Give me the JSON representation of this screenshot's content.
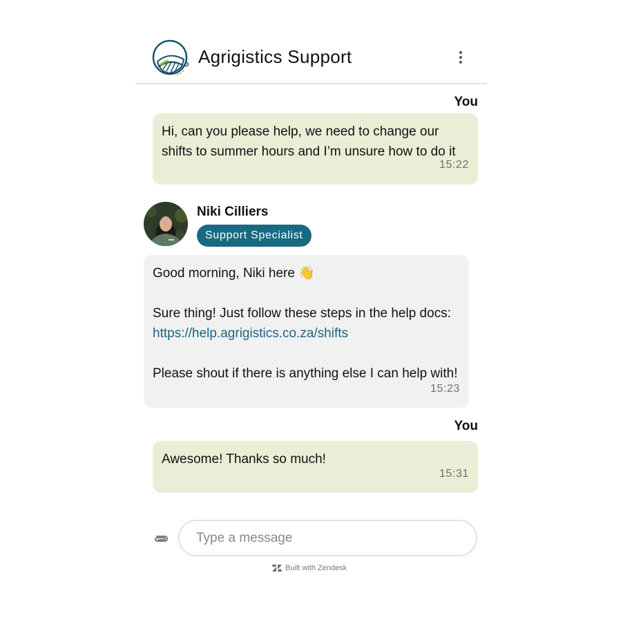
{
  "header": {
    "title": "Agrigistics Support",
    "logo_icon": "agrigistics-logo-icon",
    "menu_icon": "more-vertical-icon"
  },
  "messages": [
    {
      "sender": "You",
      "text": "Hi, can you please help, we need to change our\nshifts to summer hours and I’m unsure how to do it",
      "time": "15:22"
    },
    {
      "sender": "Niki Cilliers",
      "role": "Support Specialist",
      "line1": "Good morning, Niki here 👋",
      "line2": "Sure thing! Just follow these steps in the help docs:",
      "link": "https://help.agrigistics.co.za/shifts",
      "line3": "Please shout if there is anything else I can help with!",
      "time": "15:23"
    },
    {
      "sender": "You",
      "text": "Awesome! Thanks so much!",
      "time": "15:31"
    }
  ],
  "composer": {
    "placeholder": "Type a message",
    "attach_icon": "paperclip-icon"
  },
  "footer": {
    "text": "Built with Zendesk",
    "icon": "zendesk-logo-icon"
  },
  "colors": {
    "user_bubble": "#e9eed6",
    "agent_bubble": "#f1f1f1",
    "badge": "#186a82",
    "link": "#1d6384"
  }
}
